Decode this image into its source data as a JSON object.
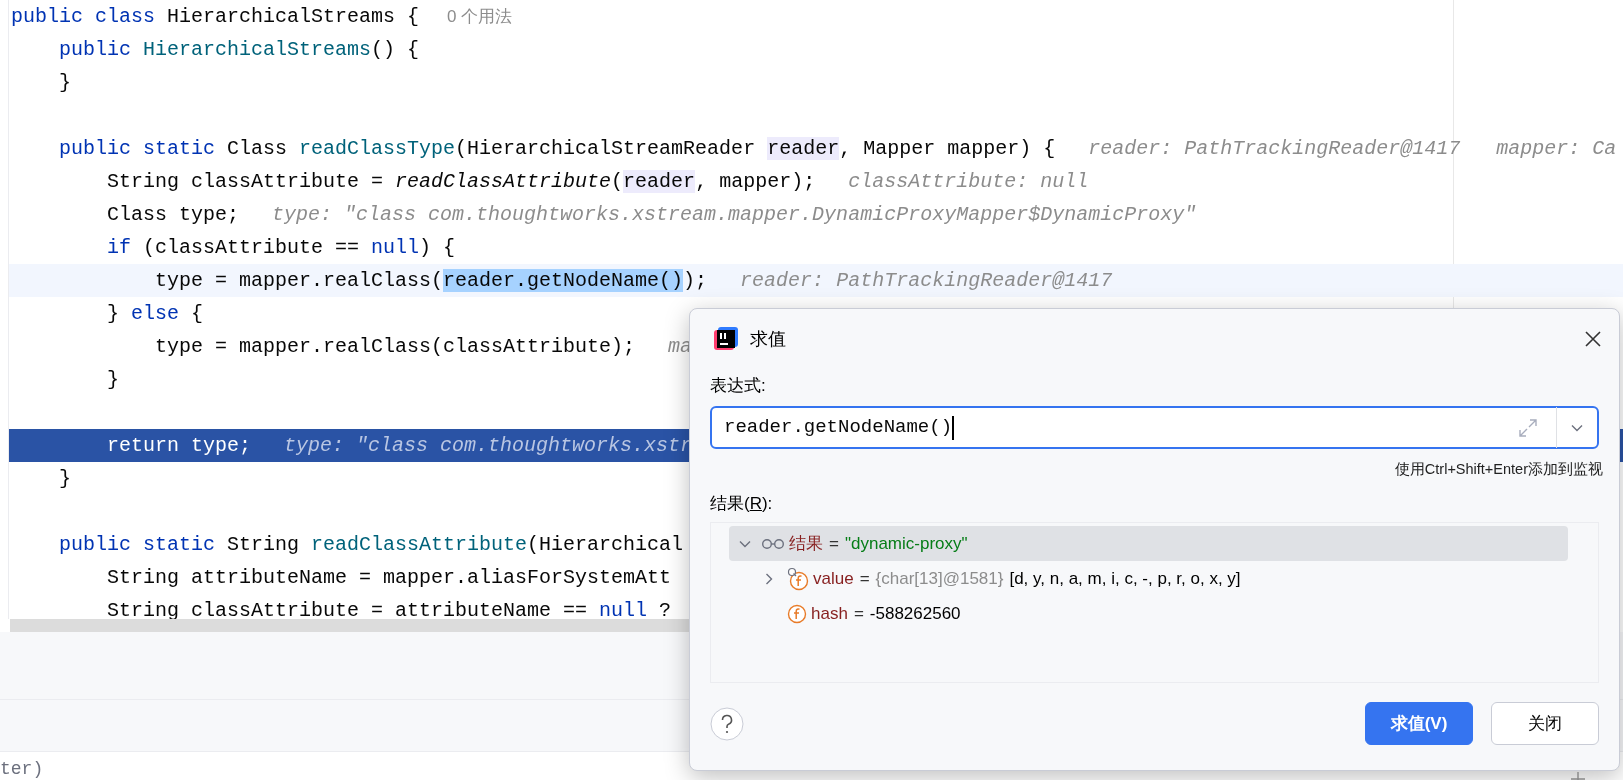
{
  "editor": {
    "lines": [
      {
        "kind": "code",
        "tokens": [
          {
            "text": "public class",
            "kind": "kw"
          },
          {
            "text": " HierarchicalStreams {",
            "kind": "plain"
          }
        ],
        "usages": "0 个用法",
        "children": [
          {
            "kind": "code",
            "tokens": [
              {
                "text": "public ",
                "kind": "kw"
              },
              {
                "text": "HierarchicalStreams",
                "kind": "decl"
              },
              {
                "text": "() {",
                "kind": "plain"
              }
            ]
          },
          {
            "kind": "code",
            "tokens": [
              {
                "text": "}",
                "kind": "plain"
              }
            ]
          },
          {
            "kind": "blank"
          },
          {
            "kind": "code",
            "tokens": [
              {
                "text": "public static ",
                "kind": "kw"
              },
              {
                "text": "Class ",
                "kind": "plain"
              },
              {
                "text": "readClassType",
                "kind": "decl"
              },
              {
                "text": "(HierarchicalStreamReader ",
                "kind": "plain"
              },
              {
                "text": "reader",
                "kind": "param"
              },
              {
                "text": ", Mapper mapper) {",
                "kind": "plain"
              }
            ],
            "hints": [
              "reader: PathTrackingReader@1417",
              "mapper: Ca"
            ],
            "children": [
              {
                "kind": "code",
                "tokens": [
                  {
                    "text": "String classAttribute = ",
                    "kind": "plain"
                  },
                  {
                    "text": "readClassAttribute",
                    "kind": "italic"
                  },
                  {
                    "text": "(",
                    "kind": "plain"
                  },
                  {
                    "text": "reader",
                    "kind": "param"
                  },
                  {
                    "text": ", mapper);",
                    "kind": "plain"
                  }
                ],
                "hints": [
                  "classAttribute: null"
                ]
              },
              {
                "kind": "code",
                "tokens": [
                  {
                    "text": "Class type;",
                    "kind": "plain"
                  }
                ],
                "hints": [
                  "type: \"class com.thoughtworks.xstream.mapper.DynamicProxyMapper$DynamicProxy\""
                ]
              },
              {
                "kind": "code",
                "tokens": [
                  {
                    "text": "if ",
                    "kind": "kw"
                  },
                  {
                    "text": "(classAttribute == ",
                    "kind": "plain"
                  },
                  {
                    "text": "null",
                    "kind": "kw"
                  },
                  {
                    "text": ") {",
                    "kind": "plain"
                  }
                ],
                "children": [
                  {
                    "kind": "current",
                    "tokens": [
                      {
                        "text": "type = mapper.realClass(",
                        "kind": "plain"
                      },
                      {
                        "text": "reader.getNodeName()",
                        "kind": "selection"
                      },
                      {
                        "text": ");",
                        "kind": "plain"
                      }
                    ],
                    "hints": [
                      "reader: PathTrackingReader@1417"
                    ]
                  }
                ]
              },
              {
                "kind": "code",
                "tokens": [
                  {
                    "text": "} ",
                    "kind": "plain"
                  },
                  {
                    "text": "else",
                    "kind": "kw"
                  },
                  {
                    "text": " {",
                    "kind": "plain"
                  }
                ],
                "children": [
                  {
                    "kind": "code",
                    "tokens": [
                      {
                        "text": "type = mapper.realClass(classAttribute);",
                        "kind": "plain"
                      }
                    ],
                    "hints": [
                      "ma"
                    ]
                  }
                ]
              },
              {
                "kind": "code",
                "tokens": [
                  {
                    "text": "}",
                    "kind": "plain"
                  }
                ]
              },
              {
                "kind": "blank"
              },
              {
                "kind": "execution",
                "tokens": [
                  {
                    "text": "return type;",
                    "kind": "plain"
                  }
                ],
                "hints": [
                  "type: \"class com.thoughtworks.xstr"
                ]
              }
            ]
          },
          {
            "kind": "code",
            "tokens": [
              {
                "text": "}",
                "kind": "plain"
              }
            ]
          },
          {
            "kind": "blank"
          },
          {
            "kind": "code",
            "tokens": [
              {
                "text": "public static ",
                "kind": "kw"
              },
              {
                "text": "String ",
                "kind": "plain"
              },
              {
                "text": "readClassAttribute",
                "kind": "decl"
              },
              {
                "text": "(Hierarchical",
                "kind": "plain"
              }
            ],
            "children": [
              {
                "kind": "code",
                "tokens": [
                  {
                    "text": "String attributeName = mapper.aliasForSystemAtt",
                    "kind": "plain"
                  }
                ]
              },
              {
                "kind": "code",
                "tokens": [
                  {
                    "text": "String classAttribute = attributeName == ",
                    "kind": "plain"
                  },
                  {
                    "text": "null",
                    "kind": "kw"
                  },
                  {
                    "text": " ?",
                    "kind": "plain"
                  }
                ]
              }
            ]
          }
        ]
      }
    ]
  },
  "console_line": "ter)",
  "dialog": {
    "title": "求值",
    "expression_label": "表达式:",
    "expression": {
      "value": "reader.getNodeName()",
      "focused": true
    },
    "hint": "使用Ctrl+Shift+Enter添加到监视",
    "result_label": {
      "before": "结果(",
      "mnemonic": "R",
      "after": "):"
    },
    "result": {
      "kind": "watch",
      "name": "结果",
      "operator": "=",
      "value": "\"dynamic-proxy\"",
      "string_value": true,
      "expanded": true,
      "selected": true,
      "children": [
        {
          "kind": "field_linked",
          "name": "value",
          "operator": "=",
          "type_info": "{char[13]@1581}",
          "value": "[d, y, n, a, m, i, c, -, p, r, o, x, y]",
          "string_value": false,
          "expanded": false,
          "selected": false
        },
        {
          "kind": "field",
          "name": "hash",
          "operator": "=",
          "value": "-588262560",
          "string_value": false,
          "selected": false
        }
      ]
    },
    "buttons": [
      {
        "label": "求值(V)",
        "primary": true
      },
      {
        "label": "关闭",
        "primary": false
      }
    ]
  }
}
